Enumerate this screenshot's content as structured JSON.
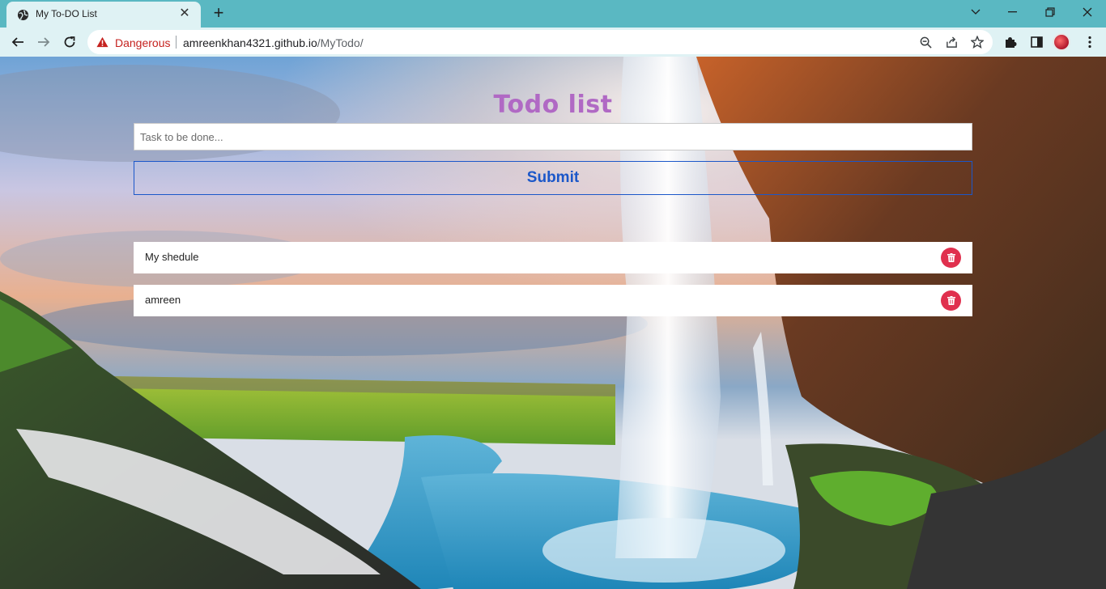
{
  "browser": {
    "tab_title": "My To-DO List",
    "security_label": "Dangerous",
    "url_host": "amreenkhan4321.github.io",
    "url_path": "/MyTodo/",
    "icons": {
      "favicon": "globe-icon",
      "close_tab": "close-icon",
      "new_tab": "plus-icon",
      "back": "arrow-left-icon",
      "forward": "arrow-right-icon",
      "reload": "reload-icon",
      "warning": "warning-triangle-icon",
      "zoom": "zoom-out-icon",
      "share": "share-icon",
      "bookmark": "star-icon",
      "extensions": "puzzle-icon",
      "side_panel": "side-panel-icon",
      "profile": "avatar",
      "menu": "more-vert-icon"
    },
    "colors": {
      "tabbar": "#5ab8c2",
      "toolbar": "#dff2f4",
      "danger": "#c5221f"
    }
  },
  "app": {
    "title": "Todo list",
    "input_placeholder": "Task to be done...",
    "input_value": "",
    "submit_label": "Submit",
    "todos": [
      {
        "text": "My shedule"
      },
      {
        "text": "amreen"
      }
    ],
    "colors": {
      "title": "#b069c4",
      "submit": "#1b57c9",
      "delete": "#e0304e"
    }
  }
}
